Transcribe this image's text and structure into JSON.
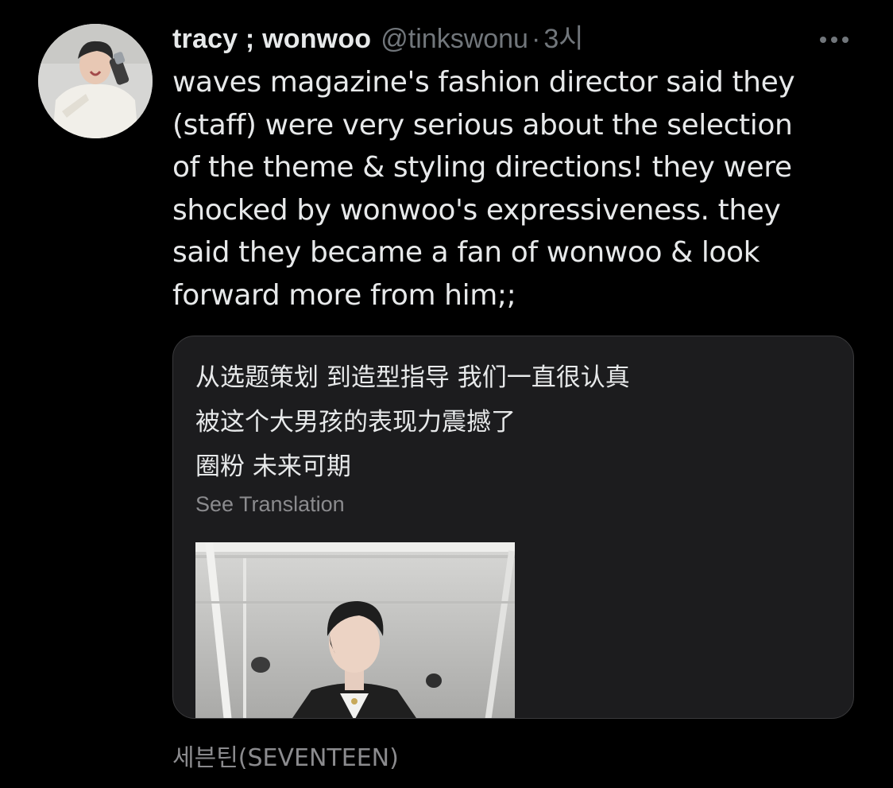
{
  "tweet": {
    "display_name": "tracy ; wonwoo",
    "handle": "@tinkswonu",
    "separator": "·",
    "time": "3시",
    "text_lines": [
      "waves magazine's fashion director said they",
      "(staff) were very serious about the selection",
      "of the theme & styling directions! they were",
      "shocked by wonwoo's expressiveness. they",
      "said they became a fan of wonwoo & look",
      "forward more from him;;"
    ]
  },
  "quote": {
    "text_lines": [
      "从选题策划 到造型指导 我们一直很认真",
      "被这个大男孩的表现力震撼了",
      "圈粉 未来可期"
    ],
    "see_translation": "See Translation"
  },
  "footer": {
    "label": "세븐틴(SEVENTEEN)"
  },
  "icons": {
    "more": "more-horizontal-icon"
  },
  "colors": {
    "background": "#000000",
    "primary_text": "#e7e9ea",
    "secondary_text": "#71767b",
    "card_background": "#1c1c1e",
    "card_border": "#3a3a3c"
  }
}
